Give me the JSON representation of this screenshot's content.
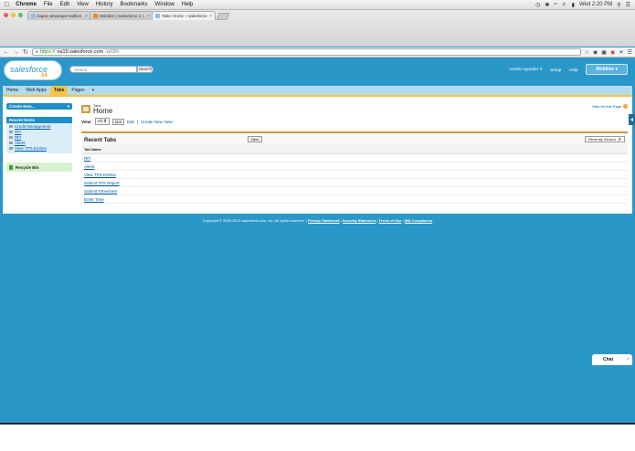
{
  "menubar": {
    "app": "Chrome",
    "items": [
      "File",
      "Edit",
      "View",
      "History",
      "Bookmarks",
      "Window",
      "Help"
    ],
    "clock": "Wed 2:20 PM"
  },
  "browser": {
    "tabs": [
      {
        "title": "bapoc-developer-edition",
        "active": false
      },
      {
        "title": "Mobilize | Salesforce 1 | ...",
        "active": false
      },
      {
        "title": "Tabs: Home ~ salesforce...",
        "active": true
      }
    ],
    "url": {
      "scheme": "https://",
      "host": "na15.salesforce.com",
      "path": "/a03/o"
    }
  },
  "header": {
    "logo": "salesforce",
    "logo_version": "14",
    "search_placeholder": "Search...",
    "search_button": "Search",
    "user": "Aurelio Agundez",
    "setup": "Setup",
    "help": "Help",
    "mobilize": "Mobilize"
  },
  "appnav": {
    "tabs": [
      {
        "label": "Home",
        "selected": false
      },
      {
        "label": "Web Apps",
        "selected": false
      },
      {
        "label": "Tabs",
        "selected": true
      },
      {
        "label": "Pages",
        "selected": false
      }
    ],
    "plus": "+"
  },
  "sidebar": {
    "create_new": "Create New...",
    "recent_title": "Recent Items",
    "recent_items": [
      "Credit Management",
      "RFI",
      "RFI",
      "Alerts",
      "View TPS Entries"
    ],
    "recycle_bin": "Recycle Bin"
  },
  "main": {
    "pre_title": "Tabs",
    "title": "Home",
    "help_link": "Help for this Page",
    "view_label": "View:",
    "view_value": "All",
    "go": "Go!",
    "edit": "Edit",
    "separator": "|",
    "create_view": "Create New View",
    "recent_tabs_title": "Recent Tabs",
    "new_button": "New",
    "recently_viewed": "Recently Viewed",
    "column": "Tab Name",
    "rows": [
      "RFI",
      "Alerts",
      "View TPS Entries",
      "Submit TPS Report",
      "Submit Timesheet",
      "Enter Time"
    ]
  },
  "footer": {
    "copyright": "Copyright © 2000-2013 salesforce.com, inc. All rights reserved.",
    "links": [
      "Privacy Statement",
      "Security Statement",
      "Terms of Use",
      "508 Compliance"
    ]
  },
  "chat": {
    "label": "Chat"
  }
}
